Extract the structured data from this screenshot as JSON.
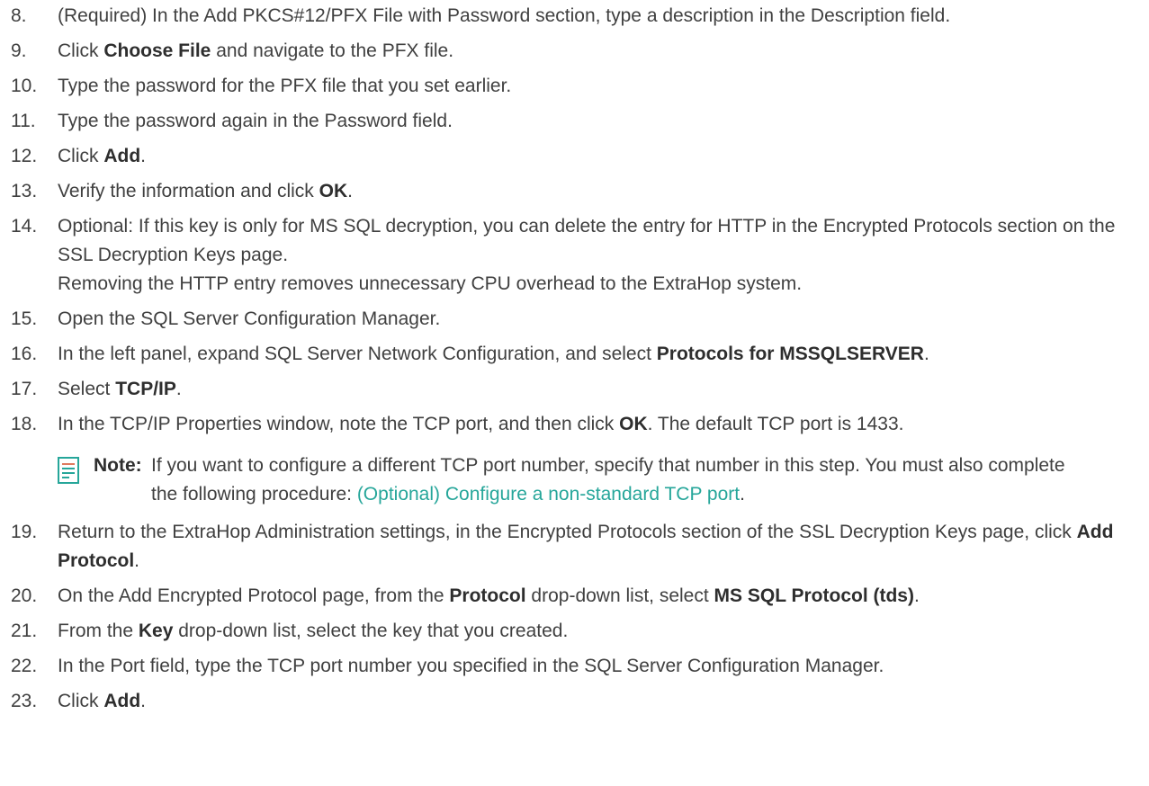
{
  "steps": [
    {
      "num": "8.",
      "parts": [
        {
          "t": "(Required) In the Add PKCS#12/PFX File with Password section, type a description in the Description field."
        }
      ]
    },
    {
      "num": "9.",
      "parts": [
        {
          "t": "Click "
        },
        {
          "t": "Choose File",
          "b": true
        },
        {
          "t": " and navigate to the PFX file."
        }
      ]
    },
    {
      "num": "10.",
      "parts": [
        {
          "t": "Type the password for the PFX file that you set earlier."
        }
      ]
    },
    {
      "num": "11.",
      "parts": [
        {
          "t": "Type the password again in the Password field."
        }
      ]
    },
    {
      "num": "12.",
      "parts": [
        {
          "t": "Click "
        },
        {
          "t": "Add",
          "b": true
        },
        {
          "t": "."
        }
      ]
    },
    {
      "num": "13.",
      "parts": [
        {
          "t": "Verify the information and click "
        },
        {
          "t": "OK",
          "b": true
        },
        {
          "t": "."
        }
      ]
    },
    {
      "num": "14.",
      "parts": [
        {
          "t": "Optional: If this key is only for MS SQL decryption, you can delete the entry for HTTP in the Encrypted Protocols section on the SSL Decryption Keys page."
        }
      ],
      "extra": "Removing the HTTP entry removes unnecessary CPU overhead to the ExtraHop system."
    },
    {
      "num": "15.",
      "parts": [
        {
          "t": "Open the SQL Server Configuration Manager."
        }
      ]
    },
    {
      "num": "16.",
      "parts": [
        {
          "t": "In the left panel, expand SQL Server Network Configuration, and select "
        },
        {
          "t": "Protocols for MSSQLSERVER",
          "b": true
        },
        {
          "t": "."
        }
      ]
    },
    {
      "num": "17.",
      "parts": [
        {
          "t": "Select "
        },
        {
          "t": "TCP/IP",
          "b": true
        },
        {
          "t": "."
        }
      ]
    },
    {
      "num": "18.",
      "parts": [
        {
          "t": "In the TCP/IP Properties window, note the TCP port, and then click "
        },
        {
          "t": "OK",
          "b": true
        },
        {
          "t": ". The default TCP port is 1433."
        }
      ],
      "note": {
        "label": "Note:",
        "text": "If you want to configure a different TCP port number, specify that number in this step. You must also complete the following procedure: ",
        "link": "(Optional) Configure a non-standard TCP port",
        "after": "."
      }
    },
    {
      "num": "19.",
      "parts": [
        {
          "t": "Return to the ExtraHop Administration settings, in the Encrypted Protocols section of the SSL Decryption Keys page, click "
        },
        {
          "t": "Add Protocol",
          "b": true
        },
        {
          "t": "."
        }
      ]
    },
    {
      "num": "20.",
      "parts": [
        {
          "t": "On the Add Encrypted Protocol page, from the "
        },
        {
          "t": "Protocol",
          "b": true
        },
        {
          "t": " drop-down list, select "
        },
        {
          "t": "MS SQL Protocol (tds)",
          "b": true
        },
        {
          "t": "."
        }
      ]
    },
    {
      "num": "21.",
      "parts": [
        {
          "t": "From the "
        },
        {
          "t": "Key",
          "b": true
        },
        {
          "t": " drop-down list, select the key that you created."
        }
      ]
    },
    {
      "num": "22.",
      "parts": [
        {
          "t": "In the Port field, type the TCP port number you specified in the SQL Server Configuration Manager."
        }
      ]
    },
    {
      "num": "23.",
      "parts": [
        {
          "t": "Click "
        },
        {
          "t": "Add",
          "b": true
        },
        {
          "t": "."
        }
      ]
    }
  ],
  "note_icon": "note-document-icon",
  "colors": {
    "text": "#404040",
    "link": "#26a69a",
    "icon": "#26a69a"
  }
}
